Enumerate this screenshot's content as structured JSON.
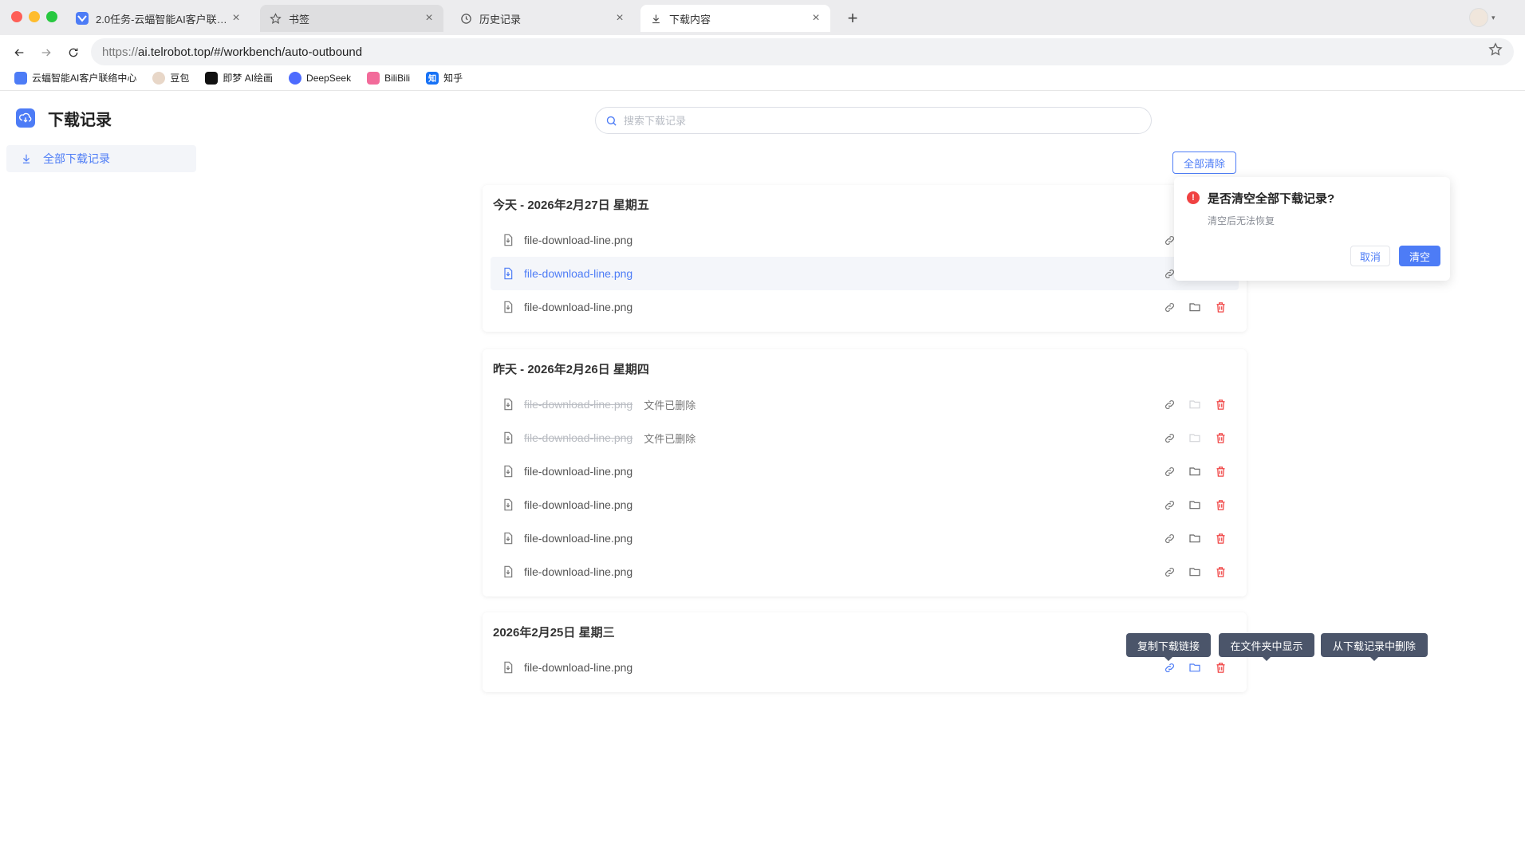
{
  "browser": {
    "tabs": [
      {
        "title": "2.0任务-云蝠智能AI客户联络...",
        "icon": "telrobot-logo-icon"
      },
      {
        "title": "书签",
        "icon": "star-icon"
      },
      {
        "title": "历史记录",
        "icon": "history-icon"
      },
      {
        "title": "下载内容",
        "icon": "download-icon"
      }
    ],
    "tab_close": "×",
    "new_tab": "+",
    "url_scheme": "https://",
    "url_rest": "ai.telrobot.top/#/workbench/auto-outbound",
    "bookmarks": [
      {
        "label": "云蝠智能AI客户联络中心",
        "color": "#4d7cf6",
        "glyph": ""
      },
      {
        "label": "豆包",
        "color": "#e8d7c8",
        "glyph": ""
      },
      {
        "label": "即梦 AI绘画",
        "color": "#111111",
        "glyph": ""
      },
      {
        "label": "DeepSeek",
        "color": "#4d6bfe",
        "glyph": ""
      },
      {
        "label": "BiliBili",
        "color": "#f26b9a",
        "glyph": ""
      },
      {
        "label": "知乎",
        "color": "#1772f6",
        "glyph": "知"
      }
    ]
  },
  "page": {
    "title": "下载记录",
    "nav_item": "全部下载记录",
    "search_placeholder": "搜索下载记录",
    "clear_all": "全部清除",
    "accent": "#4d7cf6",
    "danger": "#f04242"
  },
  "groups": [
    {
      "heading": "今天 - 2026年2月27日  星期五",
      "rows": [
        {
          "name": "file-download-line.png",
          "deleted": false
        },
        {
          "name": "file-download-line.png",
          "deleted": false,
          "hover": true
        },
        {
          "name": "file-download-line.png",
          "deleted": false
        }
      ]
    },
    {
      "heading": "昨天 - 2026年2月26日  星期四",
      "rows": [
        {
          "name": "file-download-line.png",
          "deleted": true,
          "tag": "文件已删除"
        },
        {
          "name": "file-download-line.png",
          "deleted": true,
          "tag": "文件已删除"
        },
        {
          "name": "file-download-line.png",
          "deleted": false
        },
        {
          "name": "file-download-line.png",
          "deleted": false
        },
        {
          "name": "file-download-line.png",
          "deleted": false
        },
        {
          "name": "file-download-line.png",
          "deleted": false
        }
      ]
    },
    {
      "heading": "2026年2月25日  星期三",
      "rows": [
        {
          "name": "file-download-line.png",
          "deleted": false,
          "active": true
        }
      ]
    }
  ],
  "popconfirm": {
    "title": "是否清空全部下载记录?",
    "description": "清空后无法恢复",
    "cancel": "取消",
    "confirm": "清空"
  },
  "tooltips": {
    "copy_link": "复制下载链接",
    "show_in_folder": "在文件夹中显示",
    "delete_record": "从下载记录中删除"
  }
}
